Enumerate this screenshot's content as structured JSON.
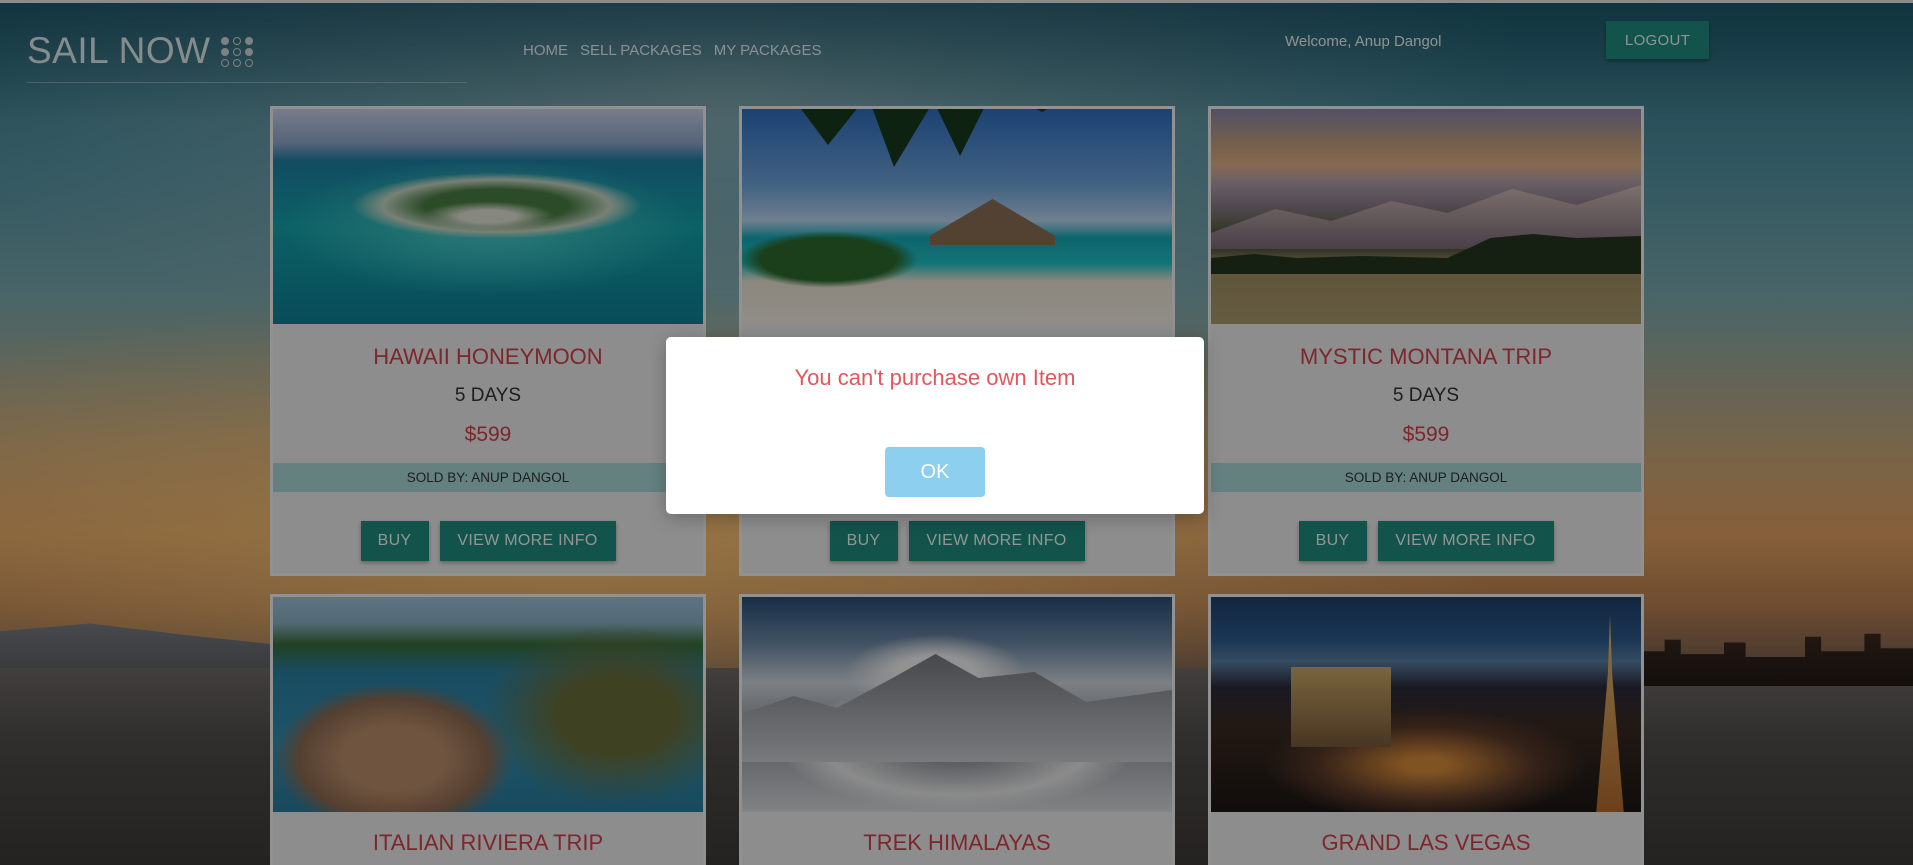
{
  "header": {
    "brand": "SAIL NOW",
    "nav": [
      "HOME",
      "SELL PACKAGES",
      "MY PACKAGES"
    ],
    "welcome": "Welcome, Anup Dangol",
    "logout_label": "LOGOUT"
  },
  "packages": [
    {
      "title": "HAWAII HONEYMOON",
      "days": "5 DAYS",
      "price": "$599",
      "seller": "SOLD BY: ANUP DANGOL",
      "buy_label": "BUY",
      "more_label": "VIEW MORE INFO"
    },
    {
      "title": "",
      "days": "",
      "price": "",
      "seller": "",
      "buy_label": "BUY",
      "more_label": "VIEW MORE INFO"
    },
    {
      "title": "MYSTIC MONTANA TRIP",
      "days": "5 DAYS",
      "price": "$599",
      "seller": "SOLD BY: ANUP DANGOL",
      "buy_label": "BUY",
      "more_label": "VIEW MORE INFO"
    },
    {
      "title": "ITALIAN RIVIERA TRIP"
    },
    {
      "title": "TREK HIMALAYAS"
    },
    {
      "title": "GRAND LAS VEGAS"
    }
  ],
  "modal": {
    "message": "You can't purchase own Item",
    "ok_label": "OK"
  },
  "colors": {
    "accent": "#1f8a7e",
    "title_red": "#d0404a",
    "seller_band": "#a7d7d6",
    "modal_text": "#e1575c",
    "ok_button": "#8ccfee"
  }
}
